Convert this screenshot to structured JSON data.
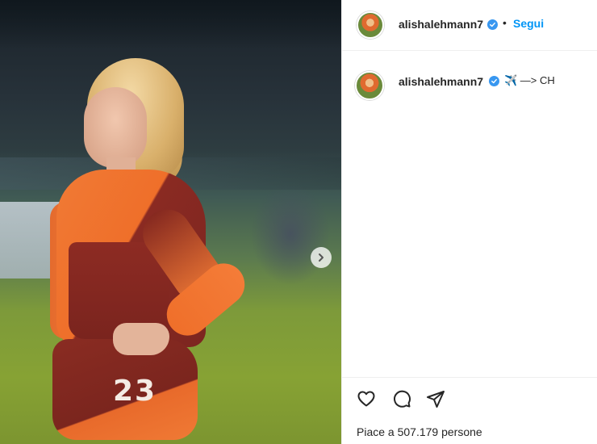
{
  "post": {
    "author": {
      "username": "alishalehmann7",
      "verified": true,
      "avatar_icon": "avatar-photo"
    },
    "follow_label": "Segui",
    "separator": "•",
    "caption": {
      "username": "alishalehmann7",
      "text": "✈️ —> CH"
    },
    "likes_text": "Piace a 507.179 persone",
    "media": {
      "shirt_number": "23",
      "carousel_icon": "chevron-right-icon"
    },
    "actions": [
      {
        "name": "like",
        "icon": "heart-icon"
      },
      {
        "name": "comment",
        "icon": "comment-bubble-icon"
      },
      {
        "name": "share",
        "icon": "paper-plane-icon"
      }
    ]
  },
  "colors": {
    "follow_blue": "#0095f6",
    "verified_blue": "#3897f0",
    "text": "#262626",
    "divider": "#efefef"
  }
}
